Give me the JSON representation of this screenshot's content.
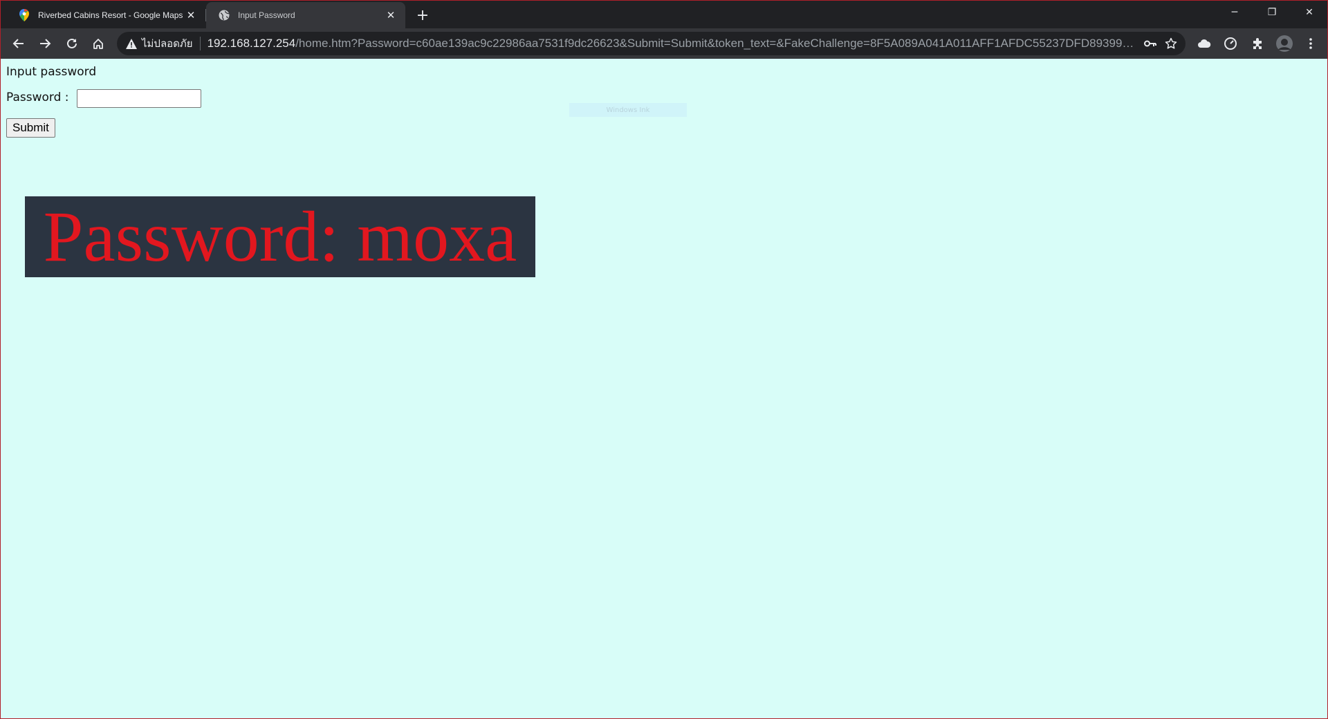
{
  "browser": {
    "tabs": [
      {
        "title": "Riverbed Cabins Resort - Google Maps",
        "active": false,
        "favicon": "google-maps-pin-icon"
      },
      {
        "title": "Input Password",
        "active": true,
        "favicon": "globe-icon"
      }
    ],
    "close_glyph": "✕",
    "new_tab_glyph": "+",
    "window_controls": {
      "minimize": "─",
      "restore": "❐",
      "close": "✕"
    },
    "address": {
      "security_label": "ไม่ปลอดภัย",
      "host": "192.168.127.254",
      "path": "/home.htm?Password=c60ae139ac9c22986aa7531f9dc26623&Submit=Submit&token_text=&FakeChallenge=8F5A089A041A011AFF1AFDC55237DFD8939960C4..."
    }
  },
  "page": {
    "heading": "Input password",
    "password_label": "Password :",
    "password_value": "",
    "submit_label": "Submit",
    "faint_text": "Windows Ink",
    "banner_text": "Password: moxa"
  },
  "colors": {
    "page_background": "#d8fdf8",
    "banner_background": "#2b3441",
    "banner_text": "#e2171f"
  }
}
